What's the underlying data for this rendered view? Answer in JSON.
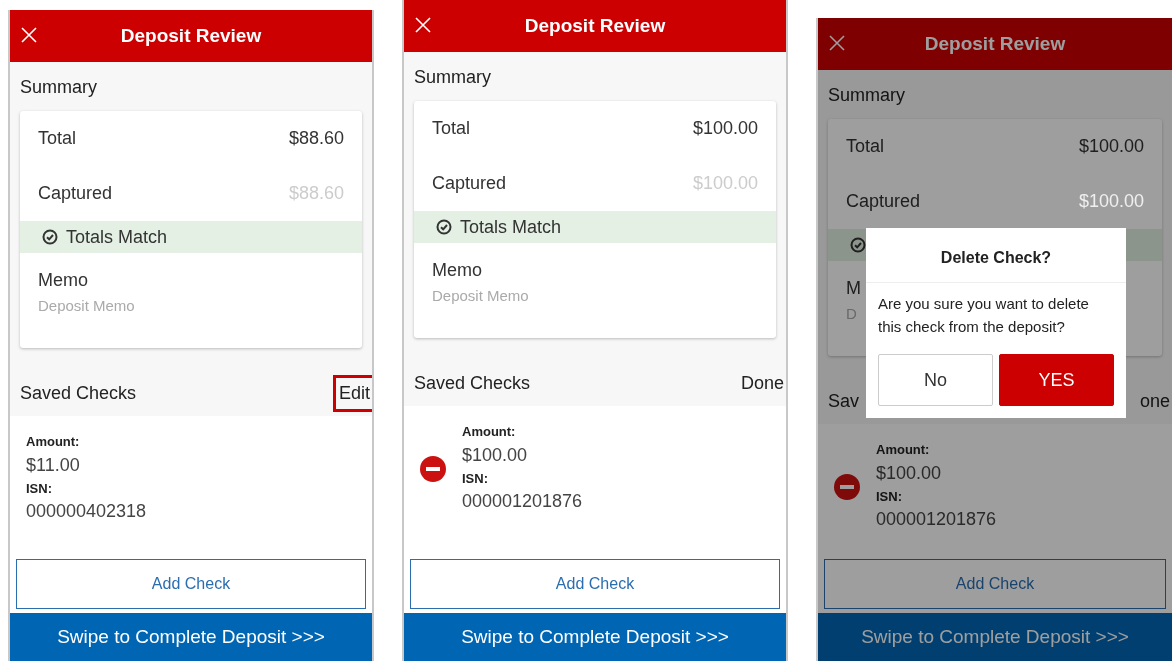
{
  "screens": [
    {
      "title": "Deposit Review",
      "summary_heading": "Summary",
      "rows": [
        {
          "label": "Total",
          "value": "$88.60",
          "muted": false
        },
        {
          "label": "Captured",
          "value": "$88.60",
          "muted": true
        }
      ],
      "match": {
        "label": "Totals Match"
      },
      "memo": {
        "label": "Memo",
        "placeholder": "Deposit Memo"
      },
      "saved_heading": "Saved Checks",
      "action": {
        "label": "Edit",
        "highlighted": true
      },
      "checks": [
        {
          "amount_label": "Amount:",
          "amount": "$11.00",
          "isn_label": "ISN:",
          "isn": "000000402318",
          "deletable": false
        }
      ],
      "add_button": "Add Check",
      "swipe": "Swipe to Complete Deposit >>>"
    },
    {
      "title": "Deposit Review",
      "summary_heading": "Summary",
      "rows": [
        {
          "label": "Total",
          "value": "$100.00",
          "muted": false
        },
        {
          "label": "Captured",
          "value": "$100.00",
          "muted": true
        }
      ],
      "match": {
        "label": "Totals Match"
      },
      "memo": {
        "label": "Memo",
        "placeholder": "Deposit Memo"
      },
      "saved_heading": "Saved Checks",
      "action": {
        "label": "Done",
        "highlighted": false
      },
      "checks": [
        {
          "amount_label": "Amount:",
          "amount": "$100.00",
          "isn_label": "ISN:",
          "isn": "000001201876",
          "deletable": true
        }
      ],
      "add_button": "Add Check",
      "swipe": "Swipe to Complete Deposit >>>"
    },
    {
      "title": "Deposit Review",
      "summary_heading": "Summary",
      "rows": [
        {
          "label": "Total",
          "value": "$100.00",
          "muted": false
        },
        {
          "label": "Captured",
          "value": "$100.00",
          "muted": true
        }
      ],
      "memo": {
        "label": "M",
        "placeholder": "D"
      },
      "saved_heading": "Sav",
      "action": {
        "label": "one",
        "highlighted": false
      },
      "checks": [
        {
          "amount_label": "Amount:",
          "amount": "$100.00",
          "isn_label": "ISN:",
          "isn": "000001201876",
          "deletable": true
        }
      ],
      "add_button": "Add Check",
      "swipe": "Swipe to Complete Deposit >>>",
      "dialog": {
        "title": "Delete Check?",
        "message": "Are you sure you want to delete this check from the deposit?",
        "buttons": [
          {
            "label": "No",
            "kind": "secondary"
          },
          {
            "label": "YES",
            "kind": "primary"
          }
        ]
      }
    }
  ]
}
